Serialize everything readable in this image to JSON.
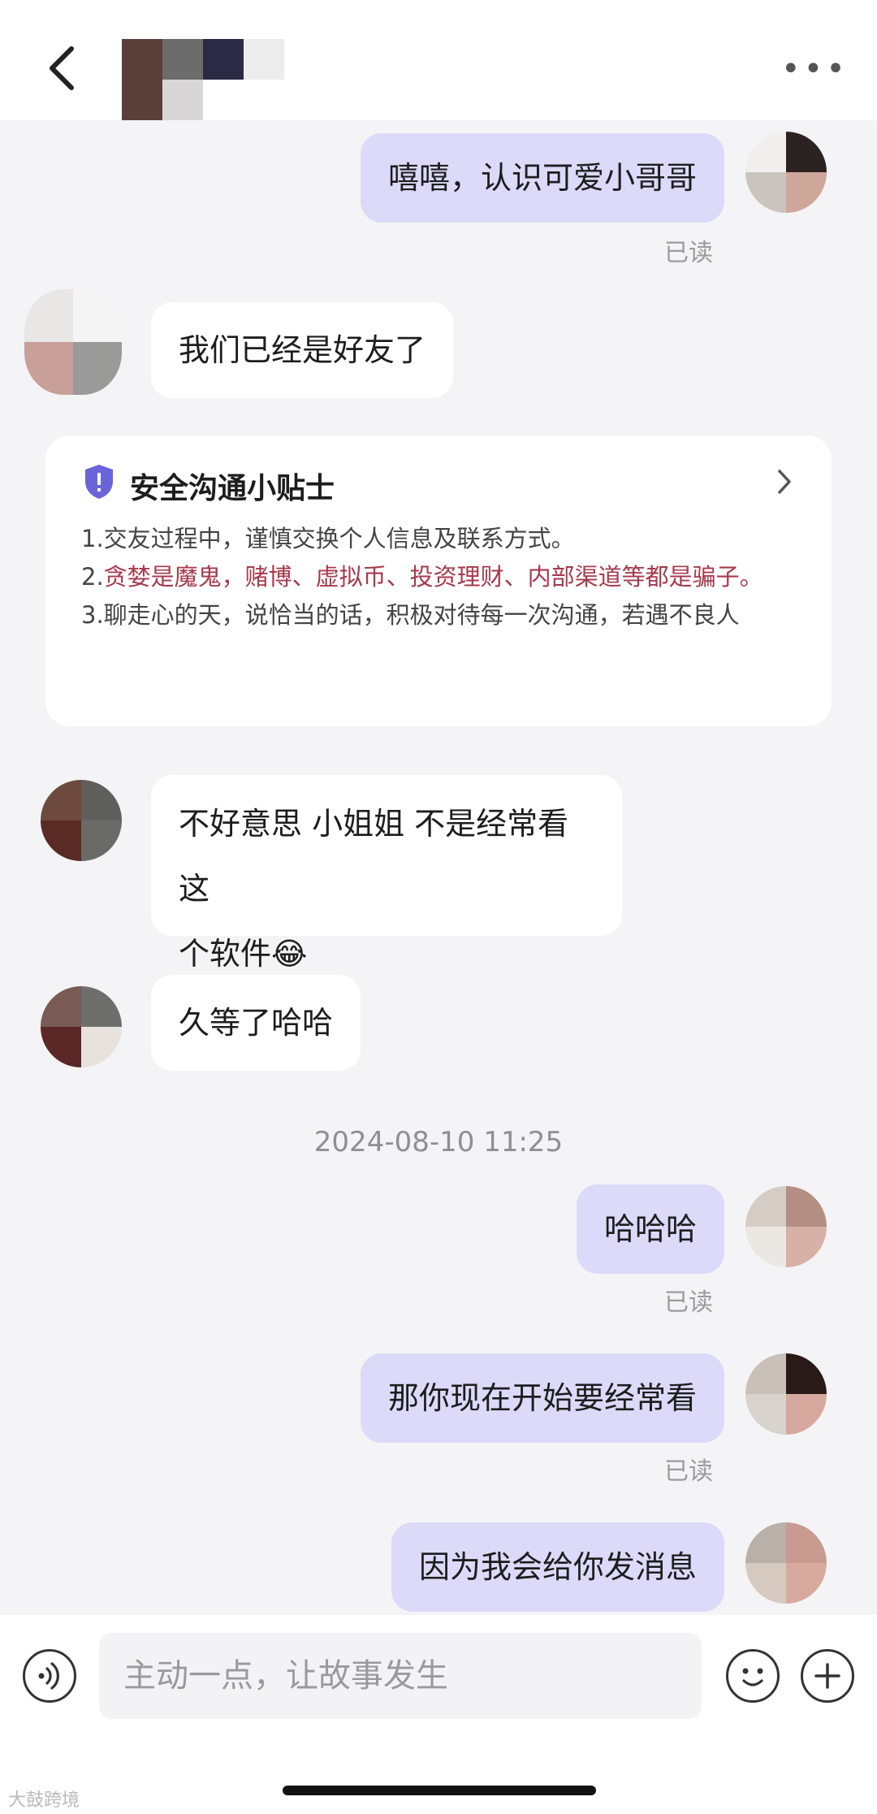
{
  "header": {
    "back_icon": "chevron-left-icon",
    "more_icon": "more-icon"
  },
  "messages": [
    {
      "side": "out",
      "text": "嘻嘻，认识可爱小哥哥",
      "status": "已读"
    },
    {
      "side": "in",
      "text": "我们已经是好友了"
    },
    {
      "side": "in",
      "text": "不好意思 小姐姐 不是经常看这",
      "text2": "个软件😂"
    },
    {
      "side": "in",
      "text": "久等了哈哈"
    },
    {
      "side": "out",
      "text": "哈哈哈",
      "status": "已读"
    },
    {
      "side": "out",
      "text": "那你现在开始要经常看",
      "status": "已读"
    },
    {
      "side": "out",
      "text": "因为我会给你发消息"
    }
  ],
  "tips": {
    "title": "安全沟通小贴士",
    "line1": "1.交友过程中，谨慎交换个人信息及联系方式。",
    "line2_num": "2.",
    "line2_red": "贪婪是魔鬼，赌博、虚拟币、投资理财、内部渠道等都是骗子。",
    "line3": "3.聊走心的天，说恰当的话，积极对待每一次沟通，若遇不良人"
  },
  "timestamp": "2024-08-10 11:25",
  "input": {
    "placeholder": "主动一点，让故事发生"
  },
  "watermark": "大鼓跨境",
  "colors": {
    "out_bubble": "#dcdaf8",
    "in_bubble": "#ffffff",
    "accent": "#6b63d9",
    "warning_text": "#a63a4d"
  }
}
